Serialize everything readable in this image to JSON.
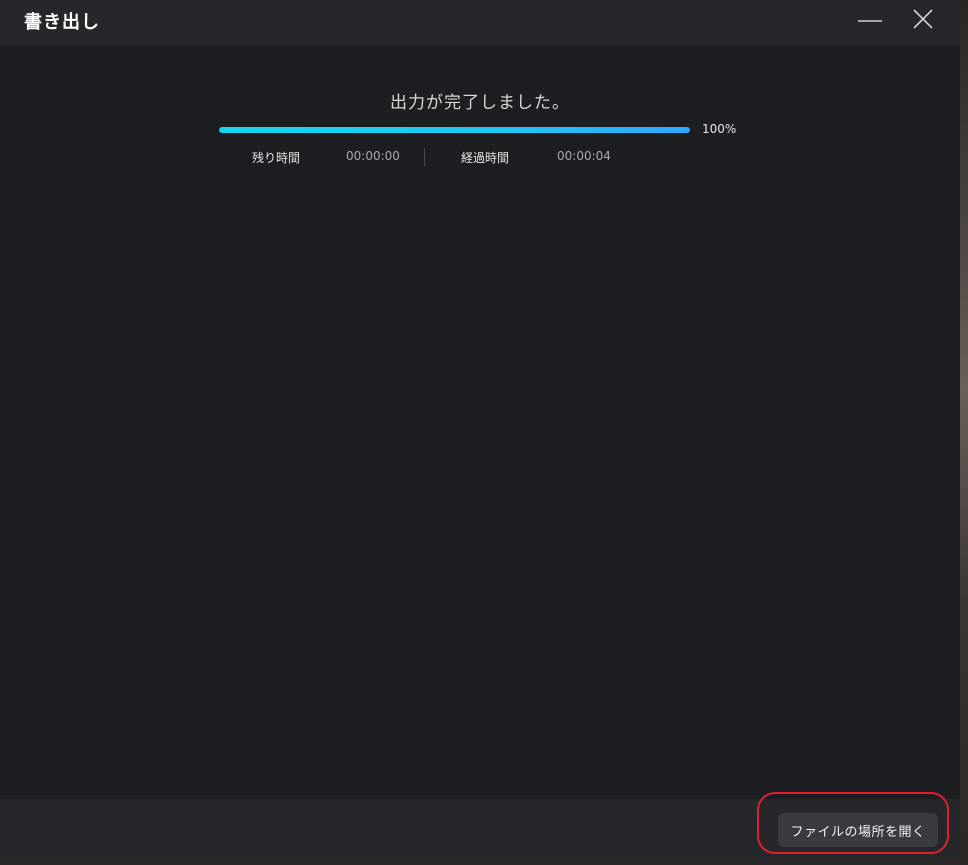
{
  "window": {
    "title": "書き出し",
    "minimize_icon": "minimize-icon",
    "close_icon": "close-icon"
  },
  "export": {
    "message": "出力が完了しました。",
    "progress_fraction": 1.0,
    "progress_text": "100%",
    "remaining_label": "残り時間",
    "remaining_value": "00:00:00",
    "elapsed_label": "経過時間",
    "elapsed_value": "00:00:04"
  },
  "footer": {
    "open_location_label": "ファイルの場所を開く"
  },
  "colors": {
    "dialog_bg": "#1d1e22",
    "bar_bg": "#26272b",
    "progress_start": "#16d6ec",
    "progress_end": "#2fa8ff",
    "highlight": "#e0202a"
  }
}
